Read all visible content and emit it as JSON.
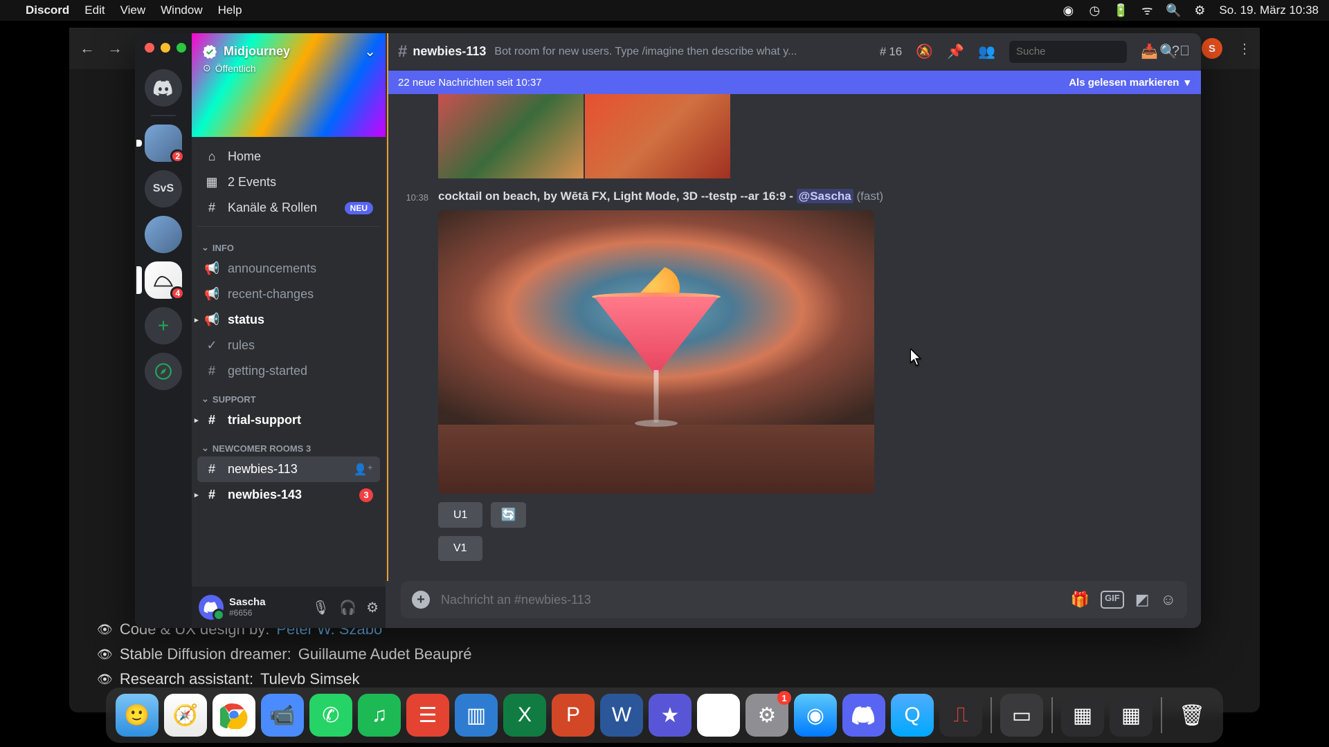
{
  "menubar": {
    "app": "Discord",
    "items": [
      "Edit",
      "View",
      "Window",
      "Help"
    ],
    "clock": "So. 19. März  10:38"
  },
  "browser": {
    "avatar_letter": "S",
    "credits": [
      {
        "label": "Code & UX design by:",
        "name": "Peter W. Szabo"
      },
      {
        "label": "Stable Diffusion dreamer:",
        "name": "Guillaume Audet Beaupré"
      },
      {
        "label": "Research assistant:",
        "name": "Tulevb Simsek"
      }
    ]
  },
  "server": {
    "name": "Midjourney",
    "public": "Öffentlich",
    "svs": "SvS",
    "badge2": "2",
    "badge4": "4"
  },
  "nav": {
    "home": "Home",
    "events": "2 Events",
    "roles": "Kanäle & Rollen",
    "neu": "NEU"
  },
  "cats": {
    "info": "INFO",
    "support": "SUPPORT",
    "newcomer": "NEWCOMER ROOMS 3"
  },
  "channels": {
    "announcements": "announcements",
    "recent": "recent-changes",
    "status": "status",
    "rules": "rules",
    "getting": "getting-started",
    "trial": "trial-support",
    "n113": "newbies-113",
    "n143": "newbies-143",
    "n143_badge": "3"
  },
  "user": {
    "name": "Sascha",
    "tag": "#6656"
  },
  "header": {
    "channel": "newbies-113",
    "topic": "Bot room for new users. Type /imagine then describe what y...",
    "threads": "16",
    "search_ph": "Suche"
  },
  "banner": {
    "left": "22 neue Nachrichten seit 10:37",
    "right": "Als gelesen markieren"
  },
  "msg": {
    "time": "10:38",
    "prompt_a": "cocktail on beach, by Wētā FX, Light Mode, 3D --testp --ar 16:9",
    "prompt_b": " - ",
    "mention": "@Sascha",
    "fast": " (fast)",
    "u1": "U1",
    "v1": "V1",
    "reroll": "🔄"
  },
  "composer": {
    "ph": "Nachricht an #newbies-113",
    "gif": "GIF"
  },
  "dock": {
    "badge": "1",
    "items": [
      "finder",
      "safari",
      "chrome",
      "zoom",
      "whatsapp",
      "spotify",
      "todoist",
      "trello",
      "excel",
      "powerpoint",
      "word",
      "imovie",
      "drive",
      "settings",
      "cal",
      "discord",
      "quicktime",
      "voice"
    ]
  }
}
